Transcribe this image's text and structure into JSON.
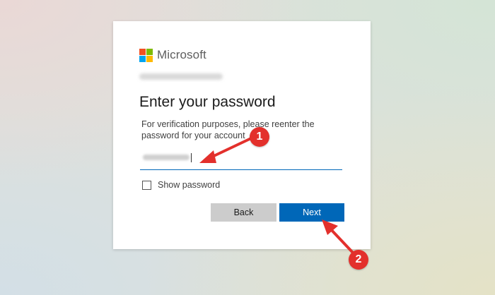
{
  "logo": {
    "text": "Microsoft",
    "colors": [
      "#f25022",
      "#7fba00",
      "#00a4ef",
      "#ffb900"
    ]
  },
  "title": "Enter your password",
  "subtitle": "For verification purposes, please reenter the password for your account",
  "show_password_label": "Show password",
  "show_password_checked": false,
  "buttons": {
    "back": "Back",
    "next": "Next"
  },
  "annotations": {
    "step1": "1",
    "step2": "2"
  },
  "colors": {
    "accent": "#0067b8",
    "annotation": "#e3302c"
  }
}
